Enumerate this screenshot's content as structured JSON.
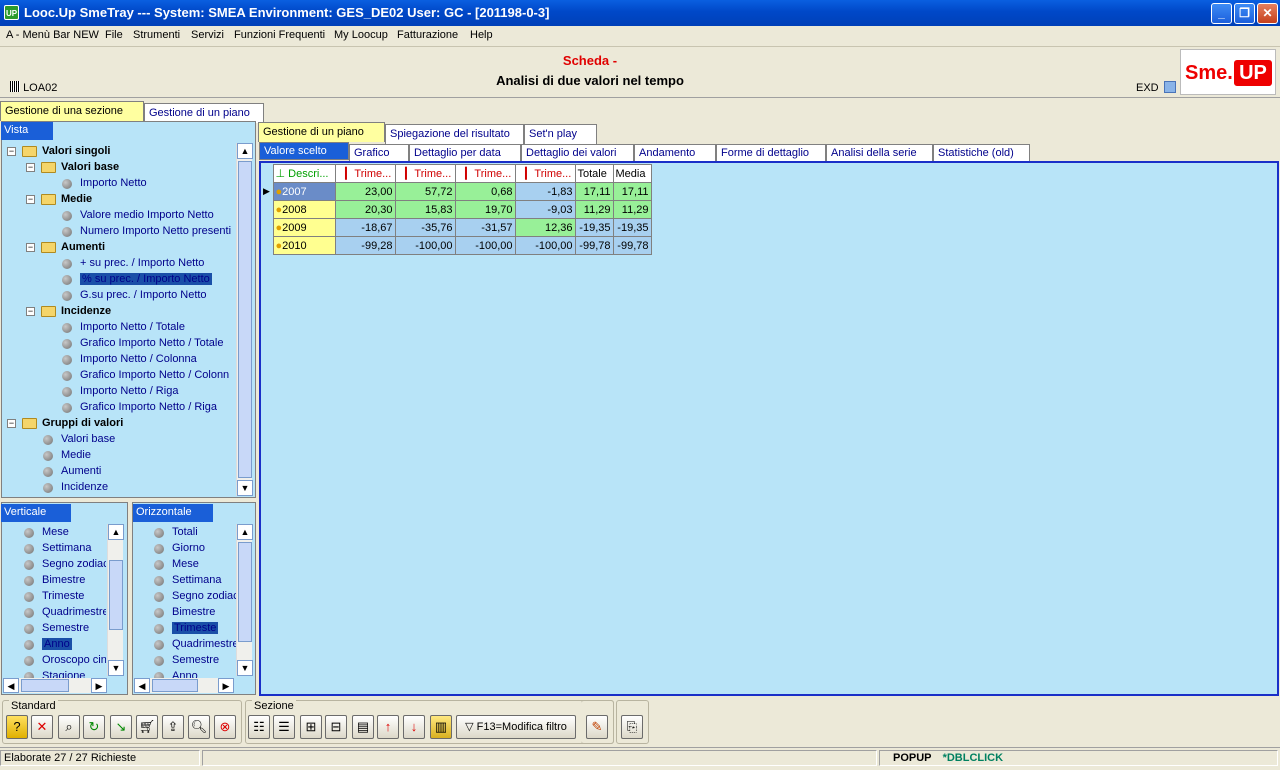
{
  "window": {
    "title": "Looc.Up SmeTray --- System: SMEA Environment: GES_DE02 User: GC - [201198-0-3]",
    "app_icon": "UP"
  },
  "menu": [
    "A - Menù Bar NEW",
    "File",
    "Strumenti",
    "Servizi",
    "Funzioni Frequenti",
    "My Loocup",
    "Fatturazione",
    "Help"
  ],
  "header": {
    "scheda": "Scheda -",
    "subtitle": "Analisi di due valori nel tempo",
    "code": "LOA02",
    "exd": "EXD",
    "logo_left": "Sme.",
    "logo_right": "UP"
  },
  "top_tabs": [
    "Gestione di una sezione",
    "Gestione di un piano"
  ],
  "vista": {
    "title": "Vista",
    "tree": [
      {
        "label": "Valori singoli",
        "level": 0,
        "type": "folder"
      },
      {
        "label": "Valori base",
        "level": 1,
        "type": "folder"
      },
      {
        "label": "Importo Netto",
        "level": 2,
        "type": "leaf"
      },
      {
        "label": "Medie",
        "level": 1,
        "type": "folder"
      },
      {
        "label": "Valore medio Importo Netto",
        "level": 2,
        "type": "leaf"
      },
      {
        "label": "Numero Importo Netto presenti",
        "level": 2,
        "type": "leaf"
      },
      {
        "label": "Aumenti",
        "level": 1,
        "type": "folder"
      },
      {
        "label": "+ su prec. / Importo Netto",
        "level": 2,
        "type": "leaf"
      },
      {
        "label": "% su prec. / Importo Netto",
        "level": 2,
        "type": "leaf",
        "selected": true
      },
      {
        "label": "G.su prec. / Importo Netto",
        "level": 2,
        "type": "leaf"
      },
      {
        "label": "Incidenze",
        "level": 1,
        "type": "folder"
      },
      {
        "label": "Importo Netto / Totale",
        "level": 2,
        "type": "leaf"
      },
      {
        "label": "Grafico Importo Netto / Totale",
        "level": 2,
        "type": "leaf"
      },
      {
        "label": "Importo Netto / Colonna",
        "level": 2,
        "type": "leaf"
      },
      {
        "label": "Grafico Importo Netto / Colonn",
        "level": 2,
        "type": "leaf"
      },
      {
        "label": "Importo Netto / Riga",
        "level": 2,
        "type": "leaf"
      },
      {
        "label": "Grafico Importo Netto / Riga",
        "level": 2,
        "type": "leaf"
      },
      {
        "label": "Gruppi di valori",
        "level": 0,
        "type": "folder"
      },
      {
        "label": "Valori base",
        "level": 1,
        "type": "leaf"
      },
      {
        "label": "Medie",
        "level": 1,
        "type": "leaf"
      },
      {
        "label": "Aumenti",
        "level": 1,
        "type": "leaf"
      },
      {
        "label": "Incidenze",
        "level": 1,
        "type": "leaf"
      }
    ]
  },
  "verticale": {
    "title": "Verticale",
    "items": [
      "Mese",
      "Settimana",
      "Segno zodiac",
      "Bimestre",
      "Trimeste",
      "Quadrimestre",
      "Semestre",
      "Anno",
      "Oroscopo cin",
      "Stagione"
    ],
    "selected": "Anno"
  },
  "orizzontale": {
    "title": "Orizzontale",
    "items": [
      "Totali",
      "Giorno",
      "Mese",
      "Settimana",
      "Segno zodiac",
      "Bimestre",
      "Trimeste",
      "Quadrimestre",
      "Semestre",
      "Anno"
    ],
    "selected": "Trimeste"
  },
  "right_tabs": [
    "Gestione di un piano",
    "Spiegazione del risultato",
    "Set'n play"
  ],
  "sub_tabs": [
    "Valore scelto",
    "Grafico",
    "Dettaglio per data",
    "Dettaglio dei valori",
    "Andamento",
    "Forme di dettaglio",
    "Analisi della serie",
    "Statistiche (old)"
  ],
  "grid": {
    "headers": [
      "Descri...",
      "Trime...",
      "Trime...",
      "Trime...",
      "Trime...",
      "Totale",
      "Media"
    ],
    "rows": [
      {
        "year": "2007",
        "values": [
          "23,00",
          "57,72",
          "0,68",
          "-1,83",
          "17,11",
          "17,11"
        ]
      },
      {
        "year": "2008",
        "values": [
          "20,30",
          "15,83",
          "19,70",
          "-9,03",
          "11,29",
          "11,29"
        ]
      },
      {
        "year": "2009",
        "values": [
          "-18,67",
          "-35,76",
          "-31,57",
          "12,36",
          "-19,35",
          "-19,35"
        ]
      },
      {
        "year": "2010",
        "values": [
          "-99,28",
          "-100,00",
          "-100,00",
          "-100,00",
          "-99,78",
          "-99,78"
        ]
      }
    ]
  },
  "toolbar": {
    "standard_label": "Standard",
    "sezione_label": "Sezione",
    "filter_button": "F13=Modifica filtro"
  },
  "status": {
    "left": "Elaborate 27 / 27 Richieste",
    "popup": "POPUP",
    "dblclick": "*DBLCLICK"
  }
}
